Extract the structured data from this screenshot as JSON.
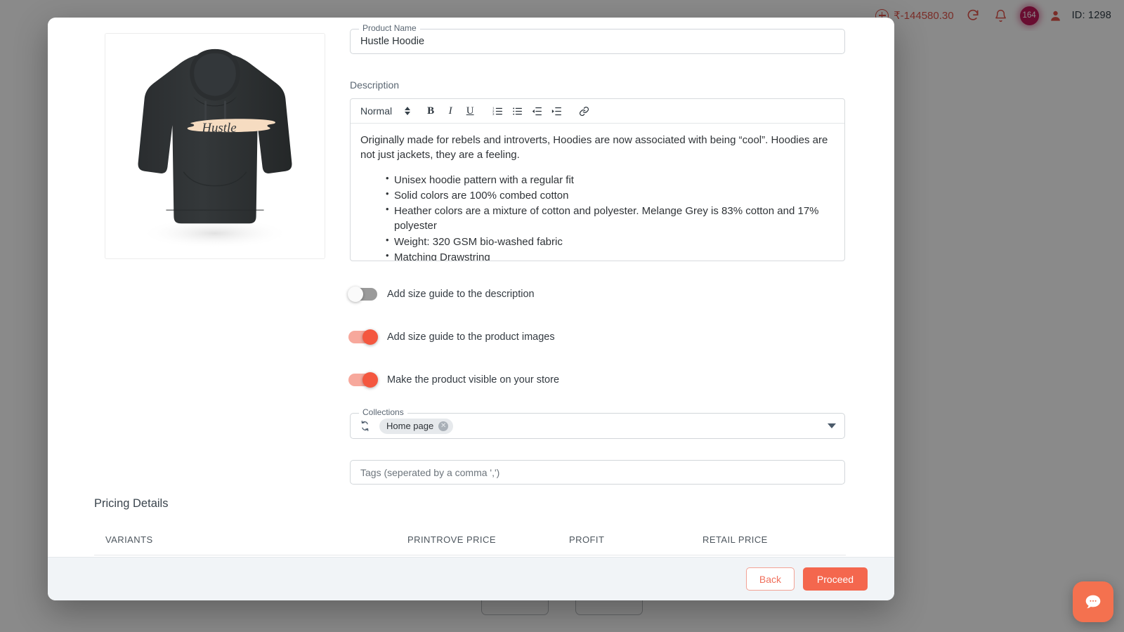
{
  "header": {
    "credit_balance": "₹-144580.30",
    "notification_count": "164",
    "user_id": "ID: 1298",
    "add_icon": "circle-plus-icon",
    "refresh_icon": "refresh-icon",
    "bell_icon": "bell-icon",
    "user_icon": "user-icon",
    "accent_color": "#e2544a",
    "badge_color": "#c2185b"
  },
  "background": {
    "button_left": "",
    "button_right": ""
  },
  "modal": {
    "product_image": {
      "alt": "Hustle Hoodie black hoodie front view",
      "print_text": "Hustle",
      "garment_color": "#2e3133",
      "print_bg_color": "#f6dcc1"
    },
    "product_name": {
      "legend": "Product Name",
      "value": "Hustle Hoodie"
    },
    "description": {
      "label": "Description",
      "toolbar": {
        "style_select": "Normal",
        "bold": "B",
        "italic": "I",
        "underline": "U",
        "ordered_list_icon": "ordered-list-icon",
        "bullet_list_icon": "bullet-list-icon",
        "outdent_icon": "outdent-icon",
        "indent_icon": "indent-icon",
        "link_icon": "link-icon"
      },
      "paragraph": "Originally made for rebels and introverts, Hoodies are now associated with being “cool”. Hoodies are not just jackets, they are a feeling.",
      "bullets": [
        "Unisex hoodie pattern with a regular fit",
        "Solid colors are 100% combed cotton",
        "Heather colors are a mixture of cotton and polyester. Melange Grey is 83% cotton and 17% polyester",
        "Weight: 320 GSM bio-washed fabric",
        "Matching Drawstring"
      ]
    },
    "toggles": [
      {
        "label": "Add size guide to the description",
        "state": "off"
      },
      {
        "label": "Add size guide to the product images",
        "state": "on"
      },
      {
        "label": "Make the product visible on your store",
        "state": "on"
      }
    ],
    "collections": {
      "legend": "Collections",
      "sync_icon": "refresh-icon",
      "chips": [
        {
          "label": "Home page",
          "remove_icon": "close-icon"
        }
      ],
      "caret_icon": "chevron-down-icon"
    },
    "tags": {
      "placeholder": "Tags (seperated by a comma ',')",
      "value": ""
    },
    "pricing": {
      "title": "Pricing Details",
      "columns": [
        "VARIANTS",
        "PRINTROVE PRICE",
        "PROFIT",
        "RETAIL PRICE"
      ],
      "rows": []
    },
    "footer": {
      "back_label": "Back",
      "proceed_label": "Proceed",
      "proceed_color": "#f4674e"
    }
  },
  "chat": {
    "icon": "chat-bubble-icon",
    "color": "#f4714f"
  }
}
